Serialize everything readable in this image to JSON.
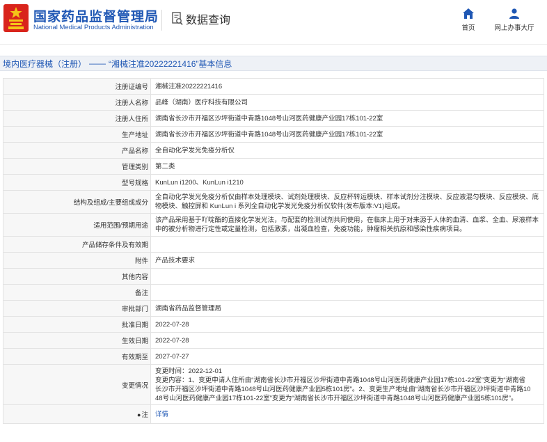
{
  "header": {
    "agency_cn": "国家药品监督管理局",
    "agency_en": "National Medical Products Administration",
    "query_title": "数据查询",
    "nav": [
      {
        "label": "首页",
        "icon": "home-icon"
      },
      {
        "label": "网上办事大厅",
        "icon": "user-icon"
      }
    ]
  },
  "colors": {
    "brand": "#1f57b4",
    "logo_red": "#d9241c",
    "label_bg": "#f7f7f7",
    "crumb_bg": "#eef1f6"
  },
  "breadcrumb": {
    "section": "境内医疗器械（注册）",
    "separator": "——",
    "current": "“湘械注准20222221416”基本信息"
  },
  "record": {
    "labels": {
      "reg_no": "注册证编号",
      "registrant": "注册人名称",
      "registrant_address": "注册人住所",
      "production_address": "生产地址",
      "product_name": "产品名称",
      "mgmt_class": "管理类别",
      "model": "型号规格",
      "structure": "结构及组成/主要组成成分",
      "scope": "适用范围/预期用途",
      "storage": "产品储存条件及有效期",
      "attachment": "附件",
      "other": "其他内容",
      "remark": "备注",
      "approver": "审批部门",
      "approval_date": "批准日期",
      "effective_date": "生效日期",
      "expiry_date": "有效期至",
      "changes": "变更情况",
      "note": "注"
    },
    "values": {
      "reg_no": "湘械注准20222221416",
      "registrant": "品峰（湖南）医疗科技有限公司",
      "registrant_address": "湖南省长沙市开福区沙坪街道中青路1048号山河医药健康产业园17栋101-22室",
      "production_address": "湖南省长沙市开福区沙坪街道中青路1048号山河医药健康产业园17栋101-22室",
      "product_name": "全自动化学发光免疫分析仪",
      "mgmt_class": "第二类",
      "model": "KunLun i1200、KunLun i1210",
      "structure_1": "全自动化学发光免疫分析仪由样本处理模块、试剂处理模块、反应杯转运模块、样本试剂分注模块、反应液混匀模块、反应模块、底",
      "structure_2": "物模块、触控屏和 KunLun i 系列全自动化学发光免疫分析仪软件(发布版本:V1)组成。",
      "scope_1": "该产品采用基于吖啶酯的直接化学发光法，与配套的检测试剂共同使用，在临床上用于对来源于人体的血清、血浆、全血、尿液样本",
      "scope_2": "中的被分析物进行定性或定量检测，包括激素，出凝血检查，免疫功能，肿瘤相关抗原和感染性疾病项目。",
      "storage": "",
      "attachment": "产品技术要求",
      "other": "",
      "remark": "",
      "approver": "湖南省药品监督管理局",
      "approval_date": "2022-07-28",
      "effective_date": "2022-07-28",
      "expiry_date": "2027-07-27",
      "changes_1": "变更时间：2022-12-01",
      "changes_2": "变更内容：1、变更申请人住所由“湖南省长沙市开福区沙坪街道中青路1048号山河医药健康产业园17栋101-22室”变更为“湖南省",
      "changes_3": "长沙市开福区沙坪街道中青路1048号山河医药健康产业园5栋101房”。2、变更生产地址由“湖南省长沙市开福区沙坪街道中青路10",
      "changes_4": "48号山河医药健康产业园17栋101-22室”变更为“湖南省长沙市开福区沙坪街道中青路1048号山河医药健康产业园5栋101房”。",
      "note_link": "详情"
    }
  }
}
